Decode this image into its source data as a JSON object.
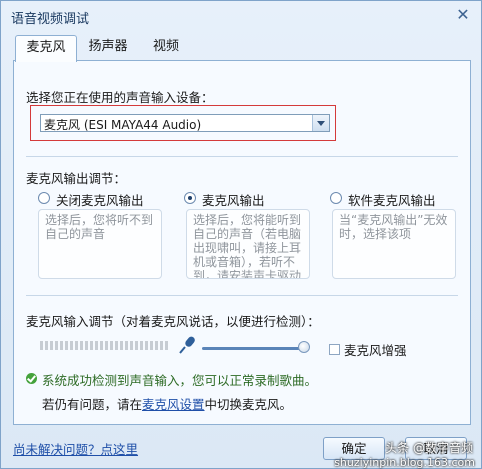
{
  "window": {
    "title": "语音视频调试"
  },
  "tabs": [
    {
      "label": "麦克风"
    },
    {
      "label": "扬声器"
    },
    {
      "label": "视频"
    }
  ],
  "device": {
    "label": "选择您正在使用的声音输入设备：",
    "selected": "麦克风 (ESI MAYA44 Audio)"
  },
  "output": {
    "label": "麦克风输出调节：",
    "options": [
      {
        "label": "关闭麦克风输出",
        "desc": "选择后，您将听不到自己的声音",
        "selected": false
      },
      {
        "label": "麦克风输出",
        "desc": "选择后，您将能听到自己的声音（若电脑出现啸叫，请接上耳机或音箱），若听不到，请安装声卡驱动",
        "selected": true
      },
      {
        "label": "软件麦克风输出",
        "desc": "当“麦克风输出”无效时，选择该项",
        "selected": false
      }
    ]
  },
  "input": {
    "label": "麦克风输入调节（对着麦克风说话，以便进行检测）：",
    "boost_label": "麦克风增强",
    "boost_checked": false,
    "volume_level": 1.0,
    "status": "系统成功检测到声音输入，您可以正常录制歌曲。",
    "hint_prefix": "若仍有问题，请在",
    "hint_link": "麦克风设置",
    "hint_suffix": "中切换麦克风。"
  },
  "footer": {
    "help_link": "尚未解决问题？点这里",
    "ok_label": "确定",
    "cancel_label": "取消"
  },
  "watermark": {
    "line1": "头条 @数字音频",
    "line2": "shuziyinpin.blog.163.com"
  },
  "colors": {
    "status_ok": "#45a23c",
    "highlight_border": "#d43a3a",
    "link": "#1f4fa8"
  }
}
